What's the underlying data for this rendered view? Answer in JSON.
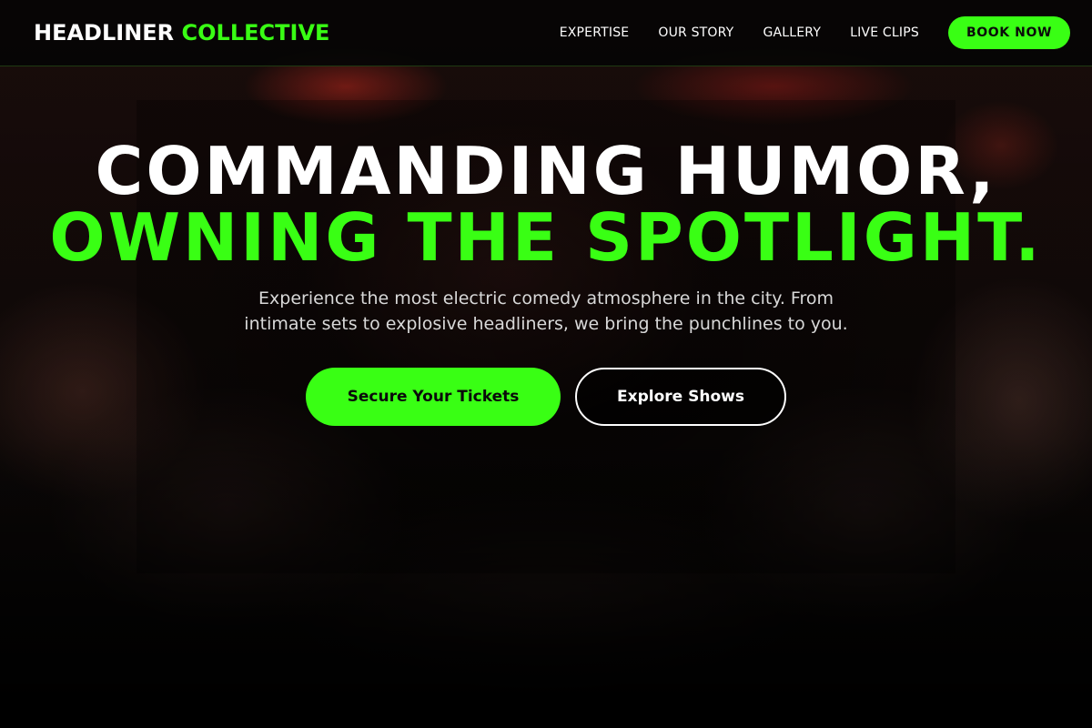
{
  "header": {
    "logo_primary": "HEADLINER",
    "logo_accent": "COLLECTIVE",
    "nav": [
      {
        "label": "EXPERTISE"
      },
      {
        "label": "OUR STORY"
      },
      {
        "label": "GALLERY"
      },
      {
        "label": "LIVE CLIPS"
      }
    ],
    "book_label": "BOOK NOW"
  },
  "hero": {
    "headline_white": "COMMANDING HUMOR,",
    "headline_green": "OWNING THE SPOTLIGHT.",
    "subtitle": "Experience the most electric comedy atmosphere in the city. From intimate sets to explosive headliners, we bring the punchlines to you.",
    "primary_cta": "Secure Your Tickets",
    "secondary_cta": "Explore Shows"
  },
  "colors": {
    "accent": "#39ff14",
    "background": "#050505",
    "text": "#ffffff"
  }
}
